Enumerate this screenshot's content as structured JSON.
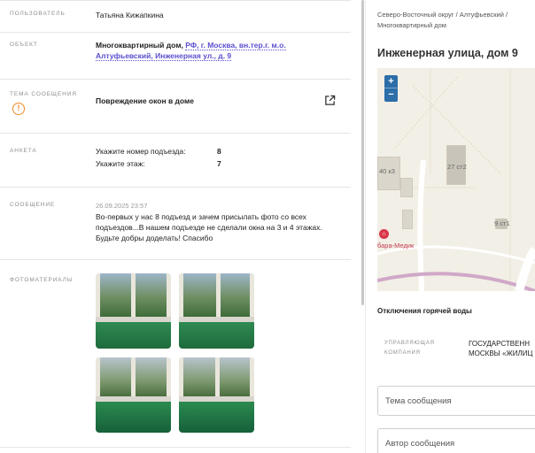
{
  "appeal": {
    "user": {
      "label": "Пользователь",
      "value": "Татьяна Кижапкина"
    },
    "object": {
      "label": "Объект",
      "type": "Многоквартирный дом,",
      "address_line1": "РФ, г. Москва, вн.тер.г. м.о.",
      "address_line2": "Алтуфьевский, Инженерная ул., д. 9"
    },
    "topic": {
      "label": "Тема сообщения",
      "value": "Повреждение окон в доме"
    },
    "survey": {
      "label": "Анкета",
      "items": [
        {
          "question": "Укажите номер подъезда:",
          "answer": "8"
        },
        {
          "question": "Укажите этаж:",
          "answer": "7"
        }
      ]
    },
    "message": {
      "label": "Сообщение",
      "date": "26.09.2025 23:57",
      "lines": [
        "Во-первых у нас 8 подъезд и зачем присылать фото со всех",
        "подъездов...В нашем подъезде не сделали окна на 3 и 4 этажах.",
        "Будьте добры доделать! Спасибо"
      ]
    },
    "photos": {
      "label": "Фотоматериалы",
      "count": 4
    }
  },
  "sidebar": {
    "breadcrumb_line1": "Северо-Восточный округ / Алтуфьевский /",
    "breadcrumb_line2": "Многоквартирный дом",
    "title": "Инженерная улица, дом 9",
    "map": {
      "zoom_in": "+",
      "zoom_out": "−",
      "labels": {
        "b1": "40 к3",
        "b2": "27 ст2",
        "b3": "9 ст1",
        "poi": "бара-Медик"
      }
    },
    "outage_title": "Отключения горячей воды",
    "management": {
      "label_line1": "Управляющая",
      "label_line2": "компания",
      "value_line1": "ГОСУДАРСТВЕНН",
      "value_line2": "МОСКВЫ «ЖИЛИЦ"
    },
    "fields": {
      "topic_placeholder": "Тема сообщения",
      "author_placeholder": "Автор сообщения"
    }
  },
  "colors": {
    "link": "#5b4fd0",
    "warning": "#f08a24",
    "map_zoom": "#2c6ea8",
    "poi": "#d9354a"
  }
}
